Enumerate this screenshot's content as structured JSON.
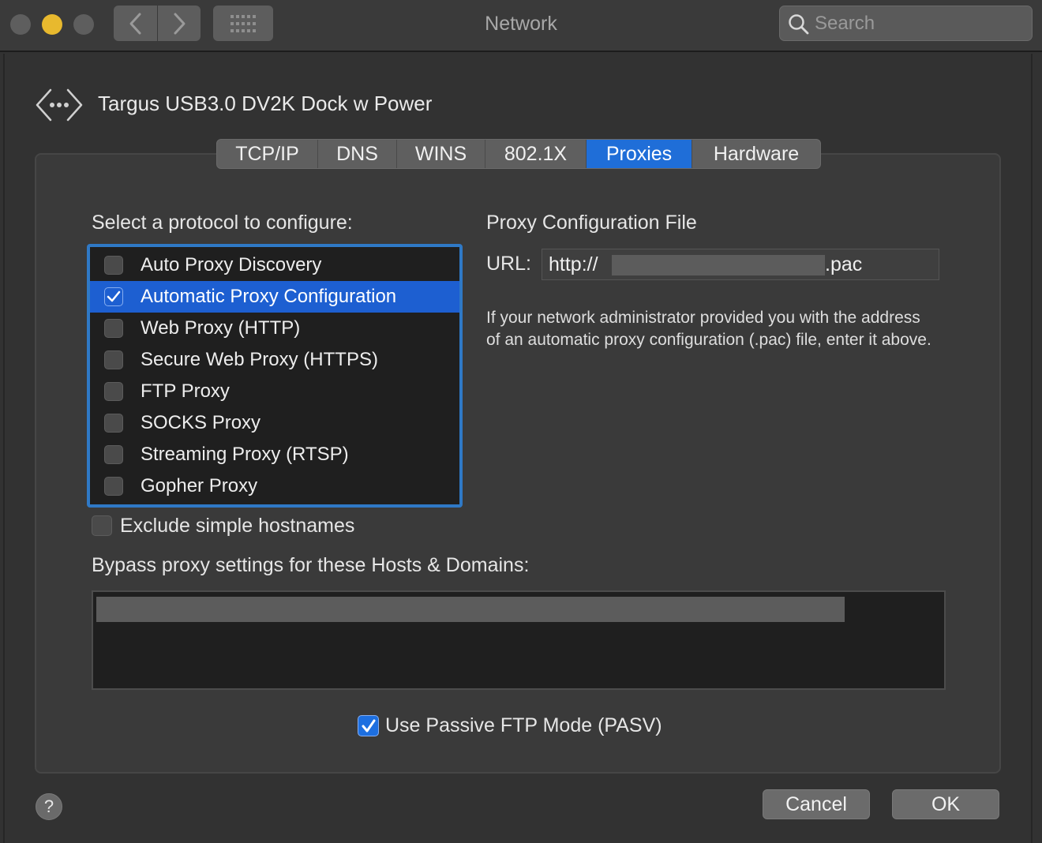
{
  "window": {
    "title": "Network"
  },
  "search": {
    "placeholder": "Search"
  },
  "interface": {
    "name": "Targus USB3.0 DV2K Dock w Power"
  },
  "tabs": [
    {
      "label": "TCP/IP",
      "active": false
    },
    {
      "label": "DNS",
      "active": false
    },
    {
      "label": "WINS",
      "active": false
    },
    {
      "label": "802.1X",
      "active": false
    },
    {
      "label": "Proxies",
      "active": true
    },
    {
      "label": "Hardware",
      "active": false
    }
  ],
  "protocols": {
    "label": "Select a protocol to configure:",
    "items": [
      {
        "label": "Auto Proxy Discovery",
        "checked": false,
        "selected": false
      },
      {
        "label": "Automatic Proxy Configuration",
        "checked": true,
        "selected": true
      },
      {
        "label": "Web Proxy (HTTP)",
        "checked": false,
        "selected": false
      },
      {
        "label": "Secure Web Proxy (HTTPS)",
        "checked": false,
        "selected": false
      },
      {
        "label": "FTP Proxy",
        "checked": false,
        "selected": false
      },
      {
        "label": "SOCKS Proxy",
        "checked": false,
        "selected": false
      },
      {
        "label": "Streaming Proxy (RTSP)",
        "checked": false,
        "selected": false
      },
      {
        "label": "Gopher Proxy",
        "checked": false,
        "selected": false
      }
    ]
  },
  "pac": {
    "title": "Proxy Configuration File",
    "url_label": "URL:",
    "url_prefix": "http://",
    "url_suffix": ".pac",
    "help": "If your network administrator provided you with the address of an automatic proxy configuration (.pac) file, enter it above."
  },
  "exclude": {
    "label": "Exclude simple hostnames",
    "checked": false
  },
  "bypass": {
    "label": "Bypass proxy settings for these Hosts & Domains:"
  },
  "pasv": {
    "label": "Use Passive FTP Mode (PASV)",
    "checked": true
  },
  "buttons": {
    "help": "?",
    "cancel": "Cancel",
    "ok": "OK"
  },
  "colors": {
    "accent": "#1d5fd1",
    "background": "#323232",
    "panel": "#3a3a3a"
  }
}
